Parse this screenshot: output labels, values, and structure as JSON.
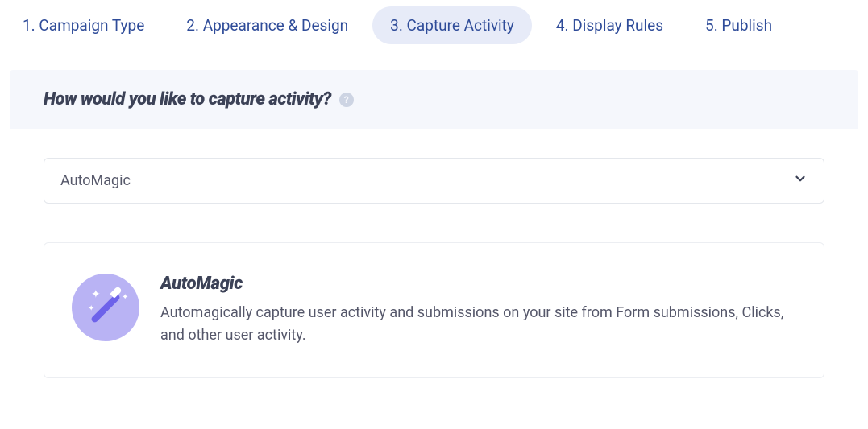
{
  "tabs": [
    {
      "label": "1. Campaign Type"
    },
    {
      "label": "2. Appearance & Design"
    },
    {
      "label": "3. Capture Activity"
    },
    {
      "label": "4. Display Rules"
    },
    {
      "label": "5. Publish"
    }
  ],
  "section": {
    "title": "How would you like to capture activity?"
  },
  "select": {
    "value": "AutoMagic"
  },
  "card": {
    "title": "AutoMagic",
    "description": "Automagically capture user activity and submissions on your site from Form submissions, Clicks, and other user activity."
  }
}
